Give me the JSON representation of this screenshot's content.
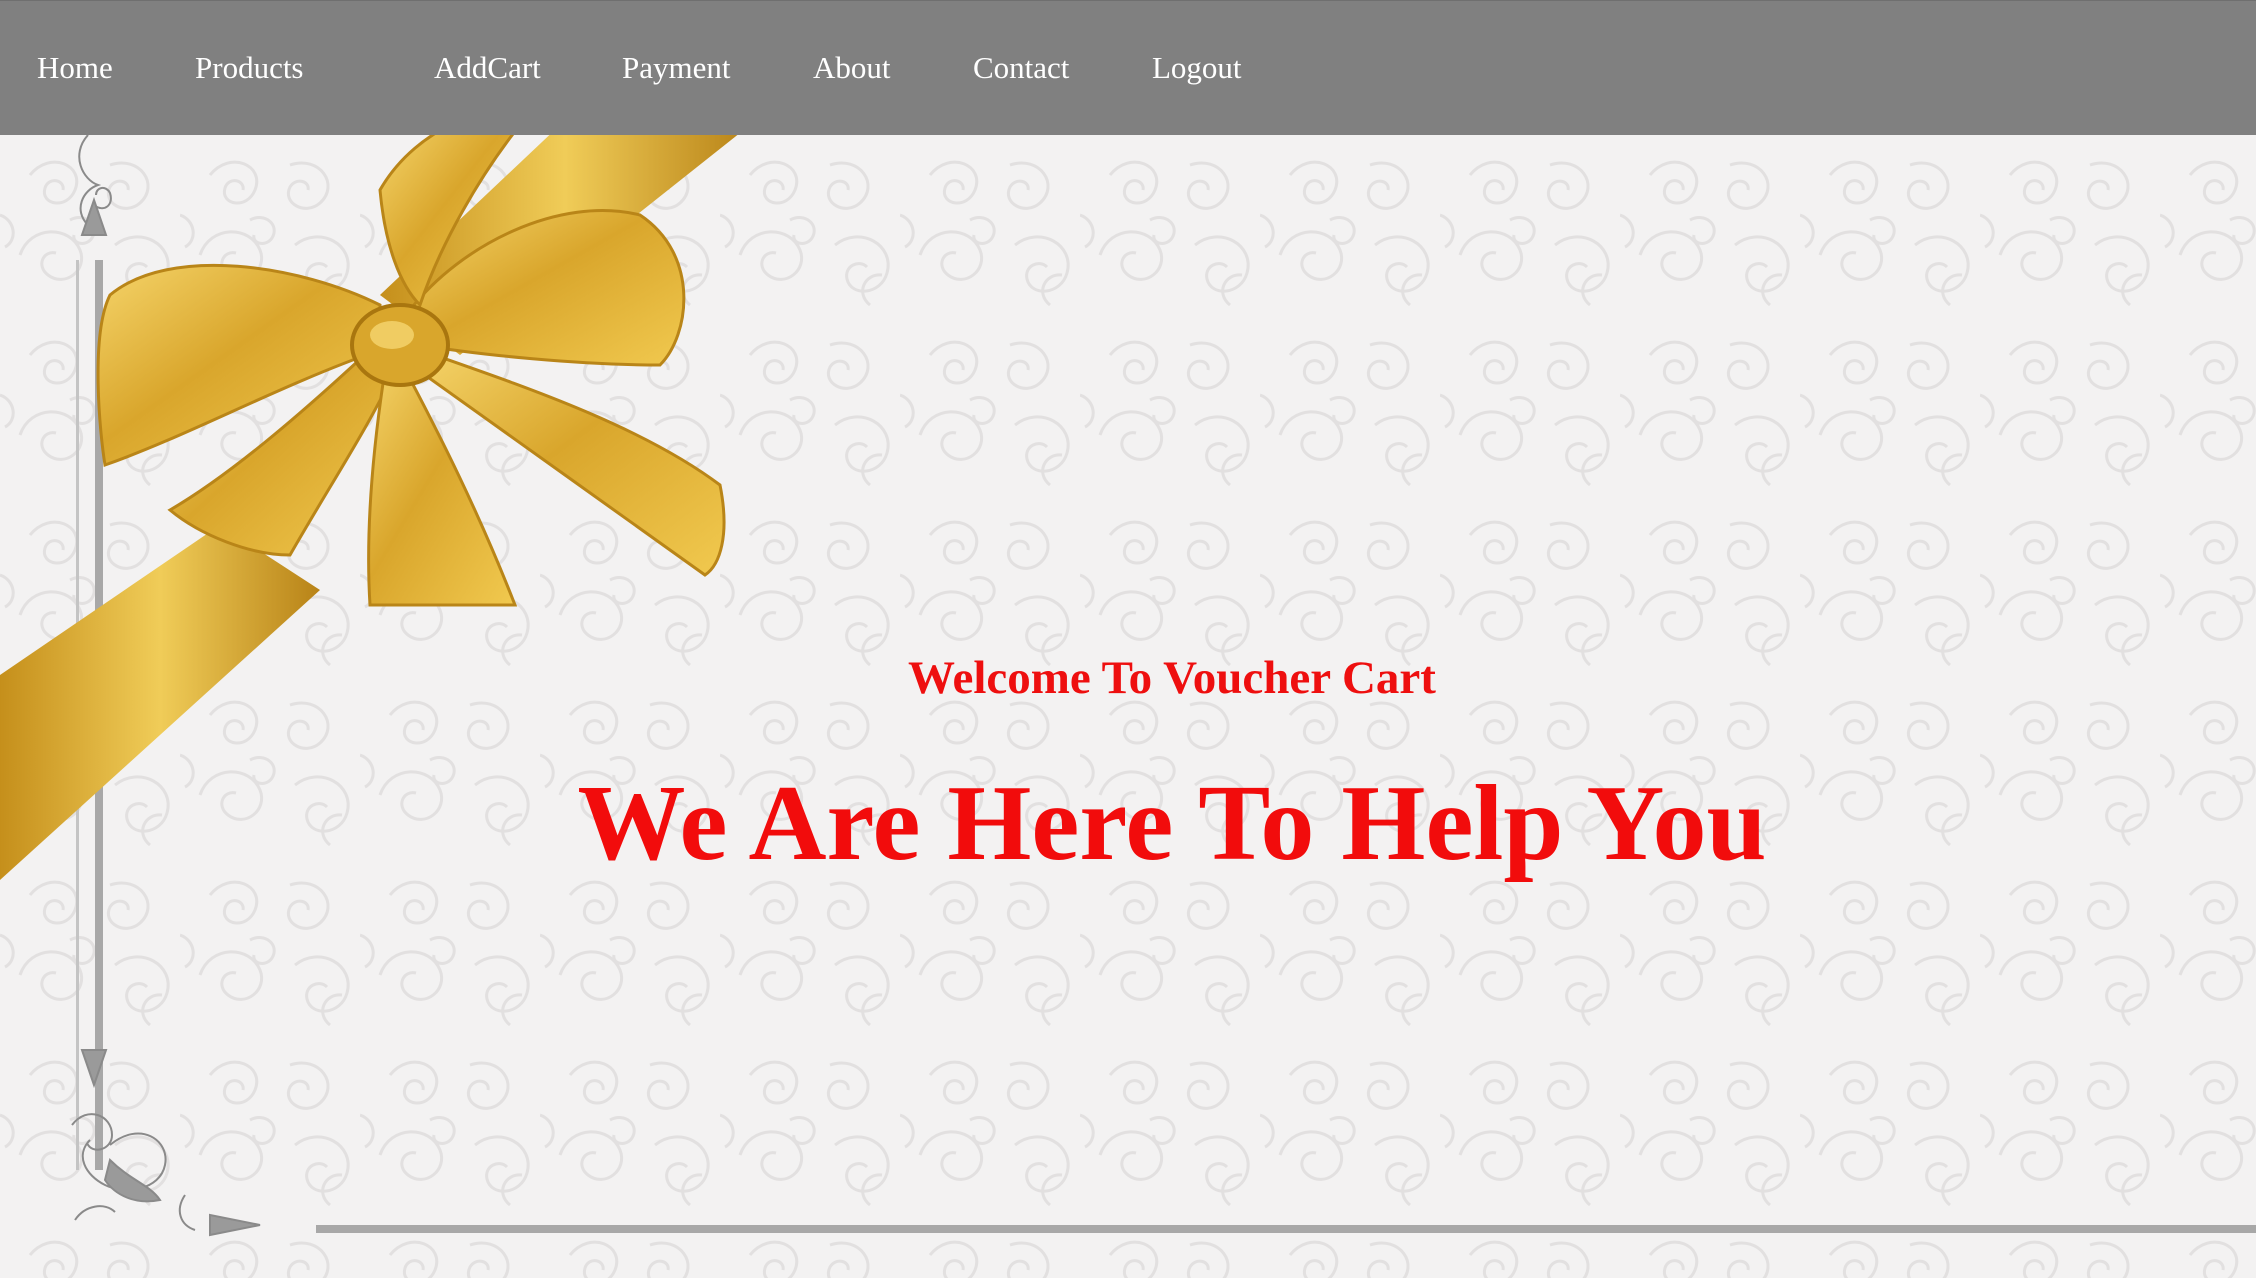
{
  "nav": {
    "items": [
      {
        "label": "Home"
      },
      {
        "label": "Products"
      },
      {
        "label": "AddCart"
      },
      {
        "label": "Payment"
      },
      {
        "label": "About"
      },
      {
        "label": "Contact"
      },
      {
        "label": "Logout"
      }
    ]
  },
  "hero": {
    "welcome": "Welcome To Voucher Cart",
    "tagline": "We Are Here To Help You"
  },
  "colors": {
    "navbar_bg": "#808080",
    "nav_text": "#ffffff",
    "heading_red": "#f20c0c",
    "ribbon_gold": "#e0b43a",
    "page_bg": "#f3f2f2"
  },
  "icons": {
    "ribbon": "gold-ribbon-bow-icon",
    "corner": "ornamental-corner-icon"
  }
}
